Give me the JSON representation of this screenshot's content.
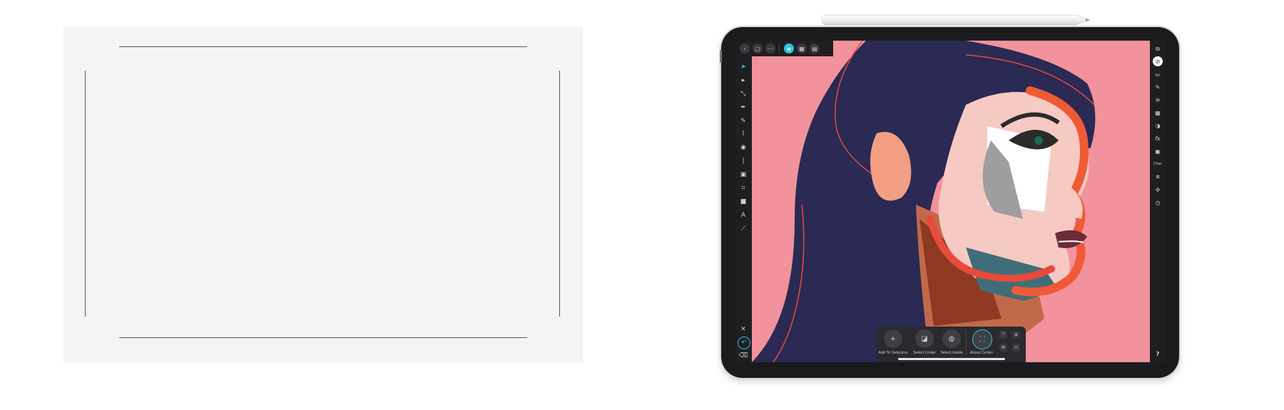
{
  "device": {
    "type": "iPad Pro with Apple Pencil"
  },
  "top_toolbar": {
    "icons": [
      "back-icon",
      "document-icon",
      "more-icon",
      "persona-designer-icon",
      "persona-pixel-icon",
      "persona-export-icon"
    ]
  },
  "left_tools": {
    "icons": [
      "move-tool-icon",
      "node-tool-icon",
      "point-transform-icon",
      "pen-tool-icon",
      "pencil-tool-icon",
      "vector-brush-icon",
      "fill-tool-icon",
      "transparency-tool-icon",
      "place-image-icon",
      "crop-tool-icon",
      "rectangle-tool-icon",
      "artistic-text-icon",
      "color-picker-icon"
    ],
    "bottom_icons": [
      "close-icon",
      "undo-history-icon",
      "trash-icon"
    ]
  },
  "right_studio": {
    "icons": [
      "navigator-icon",
      "color-icon",
      "stroke-icon",
      "brushes-icon",
      "layers-icon",
      "swatches-icon",
      "appearance-icon",
      "effects-icon",
      "styles-icon",
      "text-styles-icon",
      "transform-icon",
      "snapping-icon",
      "history-icon"
    ],
    "labels": {
      "stroke": "Str",
      "text_styles": "Char"
    },
    "help_label": "?"
  },
  "bottom_panel": {
    "buttons": [
      {
        "label": "Add To Selection",
        "icon": "plus-icon"
      },
      {
        "label": "Select Under",
        "icon": "select-under-icon"
      },
      {
        "label": "Select Inside",
        "icon": "select-inside-icon"
      },
      {
        "label": "About Center",
        "icon": "about-center-icon"
      }
    ]
  },
  "colors": {
    "canvas_pink": "#f2929c",
    "hair_navy": "#2a2a54",
    "accent_cyan": "#2fc2dc",
    "ui_dark": "#1f1f22"
  }
}
